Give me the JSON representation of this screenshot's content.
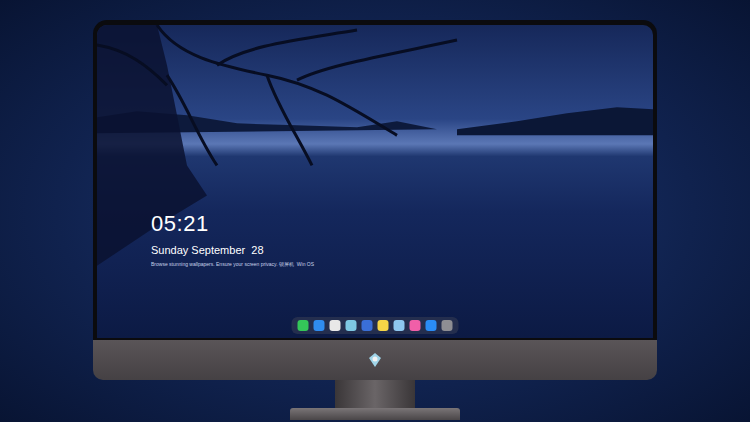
{
  "lock_screen": {
    "time": "05:21",
    "date": "Sunday September  28",
    "caption": "Browse stunning wallpapers. Ensure your screen privacy. 锁屏机  Win OS"
  },
  "dock": {
    "apps": [
      {
        "color": "#34c759"
      },
      {
        "color": "#2f8cf0"
      },
      {
        "color": "#e8e8e8"
      },
      {
        "color": "#7ec8e3"
      },
      {
        "color": "#3a6fd8"
      },
      {
        "color": "#f5d547"
      },
      {
        "color": "#8ec8f0"
      },
      {
        "color": "#f05fa8"
      },
      {
        "color": "#2a8cf5"
      },
      {
        "color": "#8e8e93"
      }
    ]
  }
}
